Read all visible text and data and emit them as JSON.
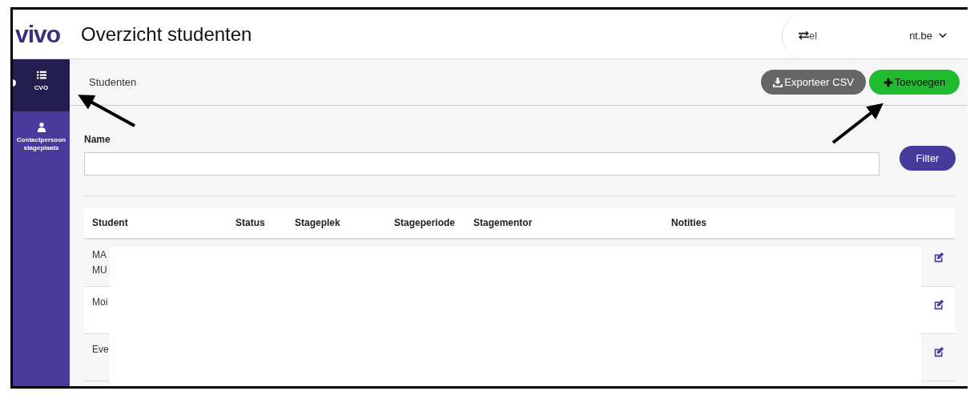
{
  "header": {
    "logo": "vivo",
    "title": "Overzicht studenten",
    "account": {
      "start": "el",
      "end": "nt.be"
    }
  },
  "sidebar": {
    "items": [
      {
        "label": "CVO",
        "kind": "list",
        "selected": true
      },
      {
        "label": "Contactpersoon stageplaats",
        "kind": "person",
        "selected": false
      }
    ]
  },
  "breadcrumb": "Studenten",
  "actions": [
    {
      "label": "Exporteer CSV",
      "kind": "export"
    },
    {
      "label": "Toevoegen",
      "kind": "add"
    }
  ],
  "filter": {
    "label": "Name",
    "button": "Filter"
  },
  "table": {
    "columns": [
      "Student",
      "Status",
      "Stageplek",
      "Stageperiode",
      "Stagementor",
      "Notities"
    ],
    "rows": [
      {
        "student": "MA\nMU"
      },
      {
        "student": "Moi"
      },
      {
        "student": "Eve"
      }
    ]
  }
}
